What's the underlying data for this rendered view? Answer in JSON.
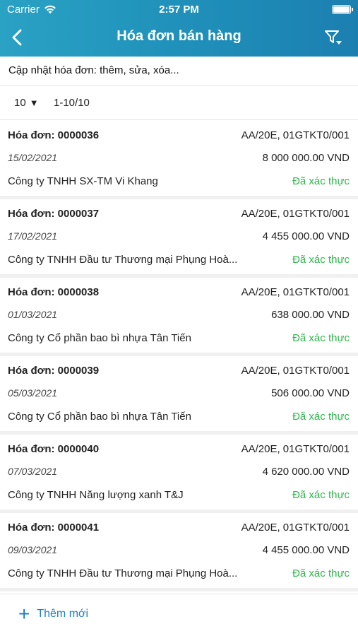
{
  "status_bar": {
    "carrier": "Carrier",
    "time": "2:57 PM"
  },
  "nav": {
    "title": "Hóa đơn bán hàng"
  },
  "subtitle": "Cập nhật hóa đơn: thêm, sửa, xóa...",
  "pager": {
    "page_size": "10",
    "range": "1-10/10"
  },
  "invoices": [
    {
      "label": "Hóa đơn:",
      "number": "0000036",
      "series": "AA/20E, 01GTKT0/001",
      "date": "15/02/2021",
      "amount": "8 000 000.00  VND",
      "company": "Công ty TNHH SX-TM Vi Khang",
      "status": "Đã xác thực"
    },
    {
      "label": "Hóa đơn:",
      "number": "0000037",
      "series": "AA/20E, 01GTKT0/001",
      "date": "17/02/2021",
      "amount": "4 455 000.00  VND",
      "company": "Công ty TNHH Đầu tư Thương mại Phụng Hoà...",
      "status": "Đã xác thực"
    },
    {
      "label": "Hóa đơn:",
      "number": "0000038",
      "series": "AA/20E, 01GTKT0/001",
      "date": "01/03/2021",
      "amount": "638 000.00  VND",
      "company": "Công ty Cổ phần bao bì nhựa Tân Tiến",
      "status": "Đã xác thực"
    },
    {
      "label": "Hóa đơn:",
      "number": "0000039",
      "series": "AA/20E, 01GTKT0/001",
      "date": "05/03/2021",
      "amount": "506 000.00  VND",
      "company": "Công ty Cổ phần bao bì nhựa Tân Tiến",
      "status": "Đã xác thực"
    },
    {
      "label": "Hóa đơn:",
      "number": "0000040",
      "series": "AA/20E, 01GTKT0/001",
      "date": "07/03/2021",
      "amount": "4 620 000.00  VND",
      "company": "Công ty TNHH Năng lượng xanh T&J",
      "status": "Đã xác thực"
    },
    {
      "label": "Hóa đơn:",
      "number": "0000041",
      "series": "AA/20E, 01GTKT0/001",
      "date": "09/03/2021",
      "amount": "4 455 000.00  VND",
      "company": "Công ty TNHH Đầu tư Thương mại Phụng Hoà...",
      "status": "Đã xác thực"
    }
  ],
  "footer": {
    "add_label": "Thêm mới",
    "add_icon": "plus-icon"
  },
  "colors": {
    "header_start": "#2aa2c4",
    "header_end": "#1c7fb0",
    "status_ok": "#2db84a",
    "accent": "#1e7fc4"
  }
}
